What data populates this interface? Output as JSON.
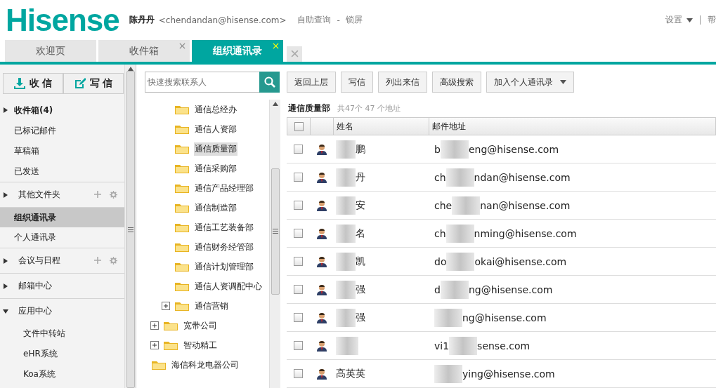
{
  "header": {
    "logo": "Hisense",
    "user_name": "陈丹丹",
    "user_email": "<chendandan@hisense.com>",
    "links": [
      "自助查询",
      "-",
      "锁屏"
    ],
    "settings": "设置",
    "help": "帮"
  },
  "tabs": [
    {
      "label": "欢迎页",
      "selected": false,
      "closable": false
    },
    {
      "label": "收件箱",
      "selected": false,
      "closable": true
    },
    {
      "label": "组织通讯录",
      "selected": true,
      "closable": true
    }
  ],
  "mail_buttons": [
    {
      "label": "收 信",
      "kind": "receive"
    },
    {
      "label": "写 信",
      "kind": "compose"
    }
  ],
  "sidebar": [
    {
      "label": "收件箱(4)",
      "kind": "folder",
      "expanded": false,
      "selected": false,
      "bold": true
    },
    {
      "label": "已标记邮件",
      "kind": "item",
      "selected": false
    },
    {
      "label": "草稿箱",
      "kind": "item",
      "selected": false
    },
    {
      "label": "已发送",
      "kind": "item",
      "selected": false
    },
    {
      "label": "其他文件夹",
      "kind": "group",
      "expanded": false,
      "tools": true
    },
    {
      "label": "组织通讯录",
      "kind": "item",
      "selected": true
    },
    {
      "label": "个人通讯录",
      "kind": "item",
      "selected": false
    },
    {
      "label": "会议与日程",
      "kind": "group",
      "expanded": false,
      "tools": true
    },
    {
      "label": "邮箱中心",
      "kind": "group",
      "expanded": false,
      "tools": false
    },
    {
      "label": "应用中心",
      "kind": "group",
      "expanded": true,
      "tools": false,
      "children": [
        {
          "label": "文件中转站"
        },
        {
          "label": "eHR系统"
        },
        {
          "label": "Koa系统"
        }
      ]
    }
  ],
  "search": {
    "placeholder": "快速搜索联系人"
  },
  "tree": [
    {
      "children": [
        {
          "children": [
            {
              "label": "通信总经办",
              "selected": false,
              "expandable": false
            },
            {
              "label": "通信人资部",
              "selected": false,
              "expandable": false
            },
            {
              "label": "通信质量部",
              "selected": true,
              "expandable": false
            },
            {
              "label": "通信采购部",
              "selected": false,
              "expandable": false
            },
            {
              "label": "通信产品经理部",
              "selected": false,
              "expandable": false
            },
            {
              "label": "通信制造部",
              "selected": false,
              "expandable": false
            },
            {
              "label": "通信工艺装备部",
              "selected": false,
              "expandable": false
            },
            {
              "label": "通信财务经管部",
              "selected": false,
              "expandable": false
            },
            {
              "label": "通信计划管理部",
              "selected": false,
              "expandable": false
            },
            {
              "label": "通信人资调配中心",
              "selected": false,
              "expandable": false
            },
            {
              "label": "通信营销",
              "selected": false,
              "expandable": true
            }
          ]
        },
        {
          "label": "宽带公司",
          "selected": false,
          "expandable": true
        },
        {
          "label": "智动精工",
          "selected": false,
          "expandable": true
        }
      ]
    },
    {
      "label": "海信科龙电器公司",
      "selected": false,
      "expandable": false
    }
  ],
  "toolbar": [
    "返回上层",
    "写信",
    "列出来信",
    "高级搜索"
  ],
  "add_button": "加入个人通讯录",
  "department": {
    "title": "通信质量部",
    "count": "共47个 47 个地址"
  },
  "table": {
    "columns": [
      "姓名",
      "邮件地址"
    ],
    "all_checked": false,
    "rows": [
      {
        "checked": false,
        "name": "鹏",
        "email_head": "b",
        "email_tail": "eng@hisense.com"
      },
      {
        "checked": false,
        "name": "丹",
        "email_head": "ch",
        "email_tail": "ndan@hisense.com"
      },
      {
        "checked": false,
        "name": "安",
        "email_head": "che",
        "email_tail": "nan@hisense.com"
      },
      {
        "checked": false,
        "name": "名",
        "email_head": "ch",
        "email_tail": "nming@hisense.com"
      },
      {
        "checked": false,
        "name": "凯",
        "email_head": "do",
        "email_tail": "okai@hisense.com"
      },
      {
        "checked": false,
        "name": "强",
        "email_head": "d",
        "email_tail": "ng@hisense.com"
      },
      {
        "checked": false,
        "name": "强",
        "email_tail": "ng@hisense.com"
      },
      {
        "checked": false,
        "email_head": "vi1",
        "email_tail": "sense.com"
      },
      {
        "checked": false,
        "name": "高英英",
        "email_tail": "ying@hisense.com"
      }
    ]
  }
}
